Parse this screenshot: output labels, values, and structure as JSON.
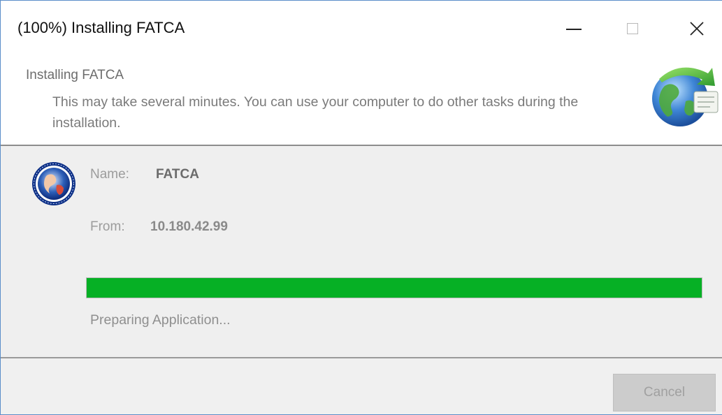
{
  "window": {
    "title": "(100%) Installing FATCA"
  },
  "header": {
    "title": "Installing FATCA",
    "description": "This may take several minutes. You can use your computer to do other tasks during the installation.",
    "icon": "globe-install-icon"
  },
  "app": {
    "name_label": "Name:",
    "name_value": "FATCA",
    "from_label": "From:",
    "from_value": "10.180.42.99",
    "icon": "app-seal-icon"
  },
  "progress": {
    "percent": 100,
    "status": "Preparing Application..."
  },
  "footer": {
    "cancel_label": "Cancel"
  },
  "colors": {
    "progress_fill": "#06b025",
    "window_border": "#5b8ec9"
  }
}
